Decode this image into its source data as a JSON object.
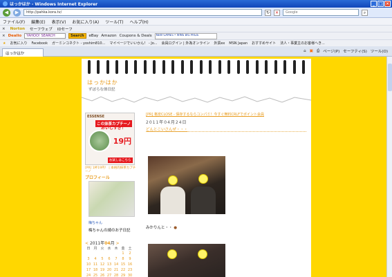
{
  "window": {
    "title": "はっかはか - Windows Internet Explorer"
  },
  "address": {
    "url": "http://pahka.kora.tv/",
    "search_placeholder": "Google"
  },
  "menu": [
    "ファイル(F)",
    "編集(E)",
    "表示(V)",
    "お気に入り(A)",
    "ツール(T)",
    "ヘルプ(H)"
  ],
  "toolbar1": [
    "Norton",
    "セーフウェブ",
    "IDセーフ"
  ],
  "toolbar2": {
    "brand": "Dealio",
    "yahoo": "YAHOO! SEARCH",
    "search": "Search",
    "items": [
      "eBay",
      "Amazon",
      "Coupons & Deals"
    ],
    "ad": "NEW GAMES • WINS BIG PRIZE"
  },
  "favorites": {
    "label": "お気に入り",
    "items": [
      "Facebook",
      "ガーミンコネクト - yoshim810...",
      "マイページでいいかん！ - Jo...",
      "会員ログイン | 外為オンライン",
      "外貨ex",
      "MSN Japan",
      "おすすめサイト",
      "法人・事業主のお客様へき..."
    ]
  },
  "tab": {
    "label": "はっかはか"
  },
  "tab_tools": [
    "ページ(P)",
    "セーフティ(S)",
    "ツール(O)"
  ],
  "blog": {
    "title": "はっかはか",
    "description": "ずぼらな体日記",
    "top_notice": "[PR] 格安CLOSE - 保存するならコンパミ！今すぐ無料CRLFでポイント会員",
    "date": "2011年04月24日",
    "post_title": "どんとこいさんぜ・・・",
    "caption": "みかりんと・・"
  },
  "ad": {
    "brand": "ESSENSE",
    "headline": "この抹茶カプチーノ",
    "subline": "おいしすぎ！",
    "price": "19円",
    "cta": "お試しはこちら",
    "caption": "[PR] 1杯19円！ | 本格的抹茶カプチーノ"
  },
  "profile": {
    "heading": "プロフィール",
    "name": "梅ちゃん",
    "desc": "梅ちゃんの綺のお子日記"
  },
  "calendar": {
    "prev": "<",
    "year": "2011年",
    "month": "04",
    "month_suffix": "月",
    "next": ">",
    "weekdays": [
      "日",
      "月",
      "火",
      "水",
      "木",
      "金",
      "土"
    ],
    "rows": [
      [
        "",
        "",
        "",
        "",
        "",
        "1",
        "2"
      ],
      [
        "3",
        "4",
        "5",
        "6",
        "7",
        "8",
        "9"
      ],
      [
        "10",
        "11",
        "12",
        "13",
        "14",
        "15",
        "16"
      ],
      [
        "17",
        "18",
        "19",
        "20",
        "21",
        "22",
        "23"
      ],
      [
        "24",
        "25",
        "26",
        "27",
        "28",
        "29",
        "30"
      ]
    ]
  }
}
